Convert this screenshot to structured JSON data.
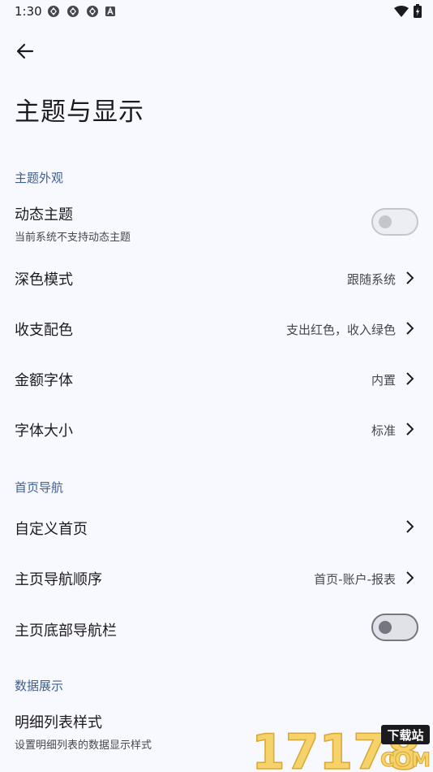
{
  "status_bar": {
    "time": "1:30",
    "notifications": [
      "sync-icon",
      "sync-icon",
      "sync-icon",
      "a-icon"
    ],
    "right_icons": [
      "wifi-icon",
      "battery-icon"
    ]
  },
  "app_bar": {
    "back_icon": "arrow-left-icon",
    "title": "主题与显示"
  },
  "sections": {
    "theme": {
      "header": "主题外观"
    },
    "home": {
      "header": "首页导航"
    },
    "data": {
      "header": "数据展示"
    }
  },
  "rows": {
    "dynamic_theme": {
      "title": "动态主题",
      "subtitle": "当前系统不支持动态主题",
      "enabled": false
    },
    "dark_mode": {
      "title": "深色模式",
      "value": "跟随系统"
    },
    "color_scheme": {
      "title": "收支配色",
      "value": "支出红色，收入绿色"
    },
    "amount_font": {
      "title": "金额字体",
      "value": "内置"
    },
    "font_size": {
      "title": "字体大小",
      "value": "标准"
    },
    "custom_home": {
      "title": "自定义首页",
      "value": ""
    },
    "nav_order": {
      "title": "主页导航顺序",
      "value": "首页-账户-报表"
    },
    "bottom_nav": {
      "title": "主页底部导航栏",
      "enabled": false
    },
    "detail_list": {
      "title": "明细列表样式",
      "subtitle": "设置明细列表的数据显示样式"
    }
  },
  "watermark": {
    "text": "17178",
    "badge": "下载站",
    "domain": "COM"
  },
  "colors": {
    "background": "#f8f9ff",
    "section_header": "#3f5f90",
    "primary_text": "#1b1b1f",
    "secondary_text": "#44474e",
    "watermark_yellow": "#f5d26a"
  }
}
